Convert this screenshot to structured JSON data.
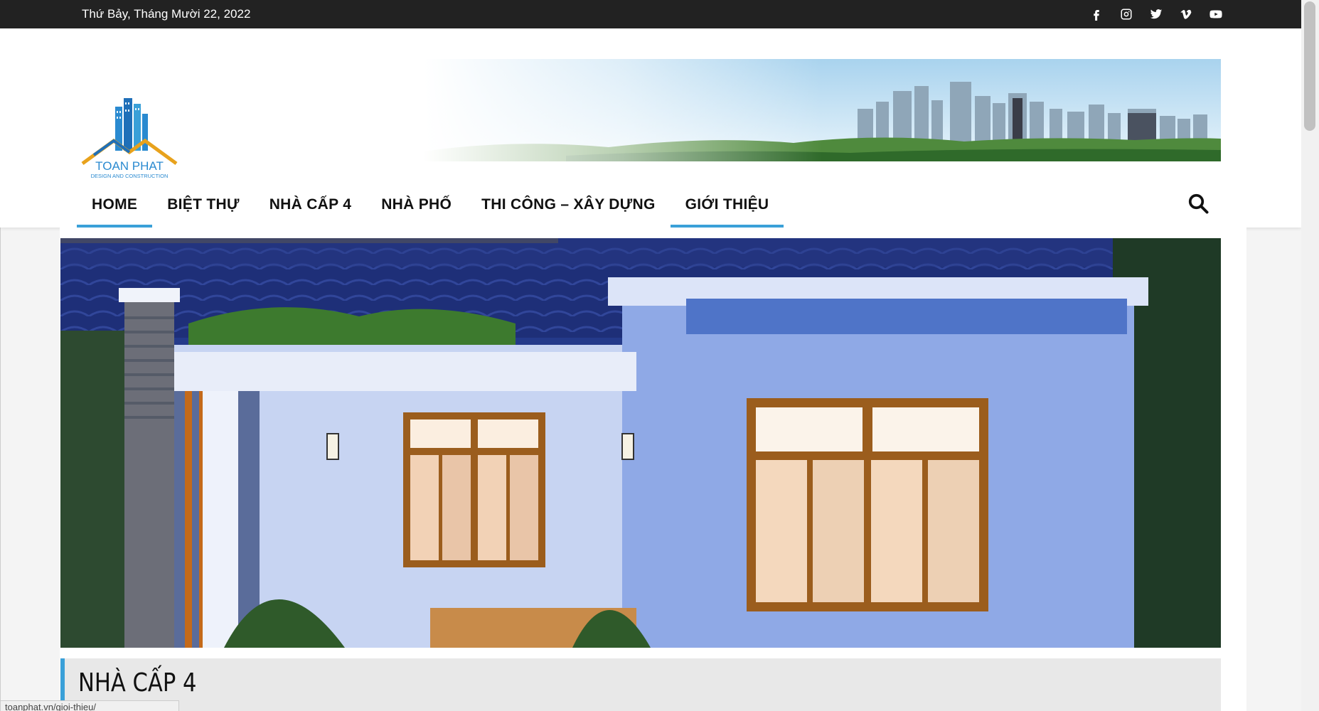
{
  "topbar": {
    "date": "Thứ Bảy, Tháng Mười 22, 2022",
    "social_icons": [
      "facebook-icon",
      "instagram-icon",
      "twitter-icon",
      "vimeo-icon",
      "youtube-icon"
    ]
  },
  "logo": {
    "line1": "TOAN PHAT",
    "line2": "DESIGN AND CONSTRUCTION"
  },
  "nav": {
    "items": [
      {
        "label": "HOME",
        "active": true
      },
      {
        "label": "BIỆT THỰ",
        "active": false
      },
      {
        "label": "NHÀ CẤP 4",
        "active": false
      },
      {
        "label": "NHÀ PHỐ",
        "active": false
      },
      {
        "label": "THI CÔNG – XÂY DỰNG",
        "active": false
      },
      {
        "label": "GIỚI THIỆU",
        "active": true
      }
    ]
  },
  "category": {
    "title": "NHÀ CẤP 4"
  },
  "status_bar": {
    "url": "toanphat.vn/gioi-thieu/"
  },
  "colors": {
    "accent": "#3aa0d8",
    "topbar": "#222222"
  }
}
